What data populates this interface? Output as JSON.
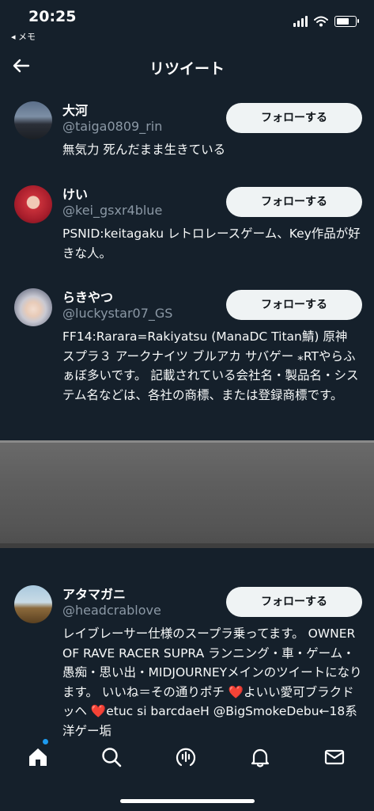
{
  "status": {
    "time": "20:25",
    "back_app": "◂ メモ"
  },
  "header": {
    "title": "リツイート"
  },
  "users": [
    {
      "name": "大河",
      "handle": "@taiga0809_rin",
      "follow": "フォローする",
      "bio": "無気力 死んだまま生きている"
    },
    {
      "name": "けい",
      "handle": "@kei_gsxr4blue",
      "follow": "フォローする",
      "bio": "PSNID:keitagaku レトロレースゲーム、Key作品が好きな人。"
    },
    {
      "name": "らきやつ",
      "handle": "@luckystar07_GS",
      "follow": "フォローする",
      "bio": "FF14:Rarara=Rakiyatsu (ManaDC Titan鯖) 原神 スプラ３ アークナイツ ブルアカ サバゲー ⁎RTやらふぁぼ多いです。 記載されている会社名・製品名・システム名などは、各社の商標、または登録商標です。"
    },
    {
      "name": "アタマガニ",
      "handle": "@headcrablove",
      "follow": "フォローする",
      "bio": "レイブレーサー仕様のスープラ乗ってます。 OWNER OF RAVE RACER SUPRA ランニング・車・ゲーム・愚痴・思い出・MIDJOURNEYメインのツイートになります。 いいね＝その通りポチ ❤️よいい愛可ブラクドッヘ ❤️etuc si barcdaeH @BigSmokeDebu←18系洋ゲー垢"
    }
  ],
  "tabs": [
    "home-icon",
    "search-icon",
    "spaces-icon",
    "notifications-icon",
    "messages-icon"
  ],
  "colors": {
    "background": "#15202b",
    "button_bg": "#eff3f4",
    "handle": "#8b98a5",
    "accent": "#1d9bf0"
  }
}
